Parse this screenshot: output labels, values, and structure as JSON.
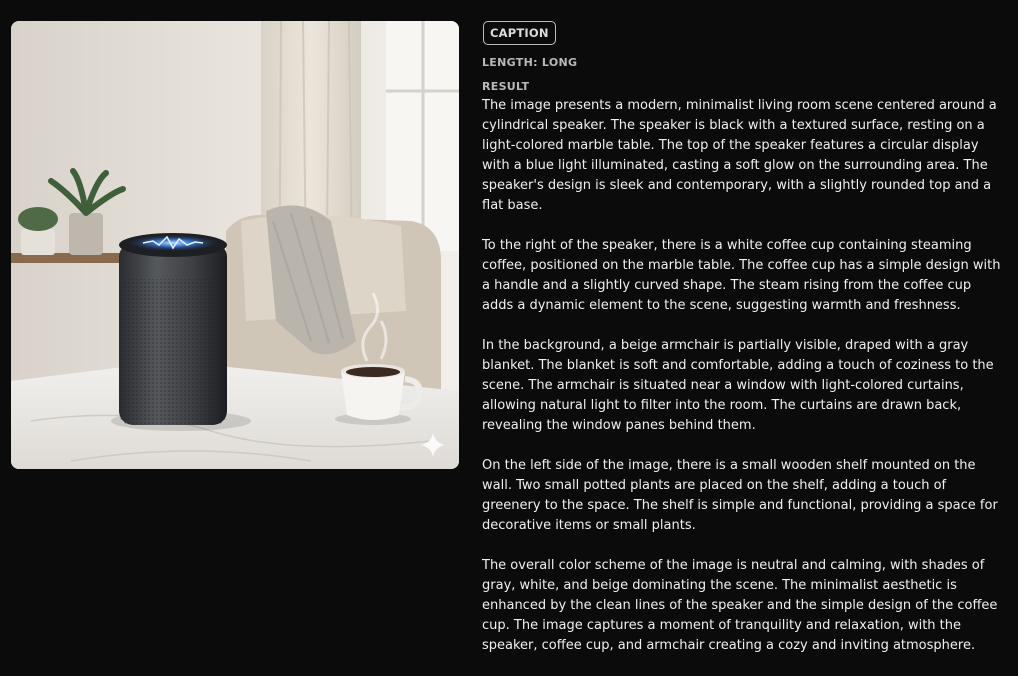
{
  "image": {
    "alt_icon": "sparkle-icon"
  },
  "badge": {
    "label": "CAPTION"
  },
  "meta": {
    "length_label": "LENGTH: LONG",
    "result_label": "RESULT"
  },
  "result": {
    "paragraphs": [
      "The image presents a modern, minimalist living room scene centered around a cylindrical speaker. The speaker is black with a textured surface, resting on a light-colored marble table. The top of the speaker features a circular display with a blue light illuminated, casting a soft glow on the surrounding area. The speaker's design is sleek and contemporary, with a slightly rounded top and a flat base.",
      "To the right of the speaker, there is a white coffee cup containing steaming coffee, positioned on the marble table. The coffee cup has a simple design with a handle and a slightly curved shape. The steam rising from the coffee cup adds a dynamic element to the scene, suggesting warmth and freshness.",
      "In the background, a beige armchair is partially visible, draped with a gray blanket. The blanket is soft and comfortable, adding a touch of coziness to the scene. The armchair is situated near a window with light-colored curtains, allowing natural light to filter into the room. The curtains are drawn back, revealing the window panes behind them.",
      "On the left side of the image, there is a small wooden shelf mounted on the wall. Two small potted plants are placed on the shelf, adding a touch of greenery to the space. The shelf is simple and functional, providing a space for decorative items or small plants.",
      "The overall color scheme of the image is neutral and calming, with shades of gray, white, and beige dominating the scene. The minimalist aesthetic is enhanced by the clean lines of the speaker and the simple design of the coffee cup. The image captures a moment of tranquility and relaxation, with the speaker, coffee cup, and armchair creating a cozy and inviting atmosphere."
    ]
  }
}
